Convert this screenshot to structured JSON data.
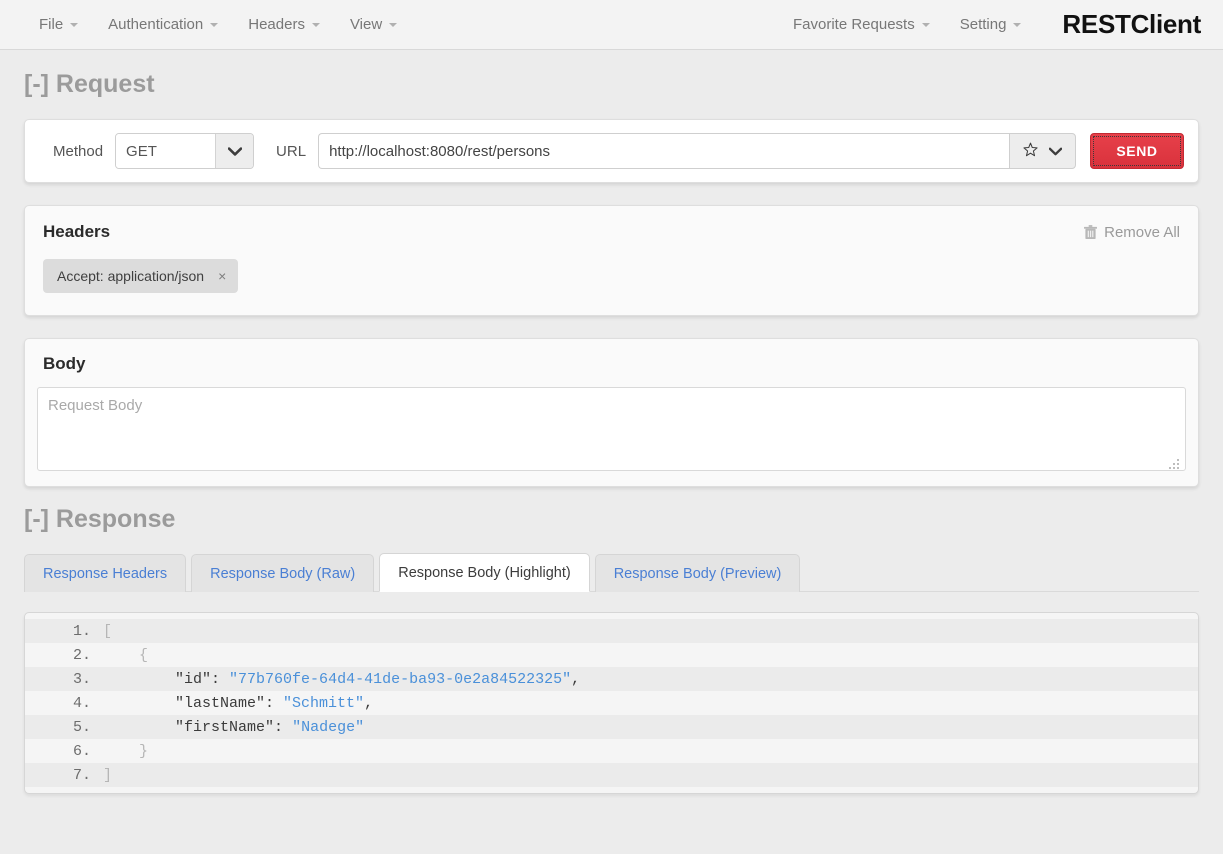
{
  "navbar": {
    "left_items": [
      {
        "label": "File",
        "icon": "chevron-down-icon"
      },
      {
        "label": "Authentication",
        "icon": "chevron-down-icon"
      },
      {
        "label": "Headers",
        "icon": "chevron-down-icon"
      },
      {
        "label": "View",
        "icon": "chevron-down-icon"
      }
    ],
    "right_items": [
      {
        "label": "Favorite Requests",
        "icon": "chevron-down-icon"
      },
      {
        "label": "Setting",
        "icon": "chevron-down-icon"
      }
    ],
    "brand": "RESTClient"
  },
  "request": {
    "section_title": "[-] Request",
    "method_label": "Method",
    "method_value": "GET",
    "method_options": [
      "GET"
    ],
    "url_label": "URL",
    "url_value": "http://localhost:8080/rest/persons",
    "url_placeholder": "",
    "favorite_icon": "star-icon",
    "favorite_dropdown_icon": "chevron-down-icon",
    "send_label": "SEND",
    "send_color": "#e13b44"
  },
  "headers": {
    "title": "Headers",
    "remove_all_label": "Remove All",
    "remove_all_icon": "trash-icon",
    "tags": [
      {
        "label": "Accept: application/json",
        "close_icon": "close-icon"
      }
    ]
  },
  "body": {
    "title": "Body",
    "placeholder": "Request Body",
    "value": "",
    "resize_icon": "resize-grip-icon"
  },
  "response": {
    "section_title": "[-] Response",
    "tabs": [
      {
        "label": "Response Headers",
        "active": false
      },
      {
        "label": "Response Body (Raw)",
        "active": false
      },
      {
        "label": "Response Body (Highlight)",
        "active": true
      },
      {
        "label": "Response Body (Preview)",
        "active": false
      }
    ],
    "code_lines": [
      {
        "n": "1.",
        "tokens": [
          {
            "t": "[",
            "c": "tok-punct"
          }
        ]
      },
      {
        "n": "2.",
        "tokens": [
          {
            "t": "    {",
            "c": "tok-punct"
          }
        ]
      },
      {
        "n": "3.",
        "tokens": [
          {
            "t": "        ",
            "c": "tok-punct"
          },
          {
            "t": "\"id\"",
            "c": "tok-key"
          },
          {
            "t": ": ",
            "c": "tok-colon"
          },
          {
            "t": "\"77b760fe-64d4-41de-ba93-0e2a84522325\"",
            "c": "tok-str"
          },
          {
            "t": ",",
            "c": "tok-key"
          }
        ]
      },
      {
        "n": "4.",
        "tokens": [
          {
            "t": "        ",
            "c": "tok-punct"
          },
          {
            "t": "\"lastName\"",
            "c": "tok-key"
          },
          {
            "t": ": ",
            "c": "tok-colon"
          },
          {
            "t": "\"Schmitt\"",
            "c": "tok-str"
          },
          {
            "t": ",",
            "c": "tok-key"
          }
        ]
      },
      {
        "n": "5.",
        "tokens": [
          {
            "t": "        ",
            "c": "tok-punct"
          },
          {
            "t": "\"firstName\"",
            "c": "tok-key"
          },
          {
            "t": ": ",
            "c": "tok-colon"
          },
          {
            "t": "\"Nadege\"",
            "c": "tok-str"
          }
        ]
      },
      {
        "n": "6.",
        "tokens": [
          {
            "t": "    }",
            "c": "tok-punct"
          }
        ]
      },
      {
        "n": "7.",
        "tokens": [
          {
            "t": "]",
            "c": "tok-punct"
          }
        ]
      }
    ]
  }
}
